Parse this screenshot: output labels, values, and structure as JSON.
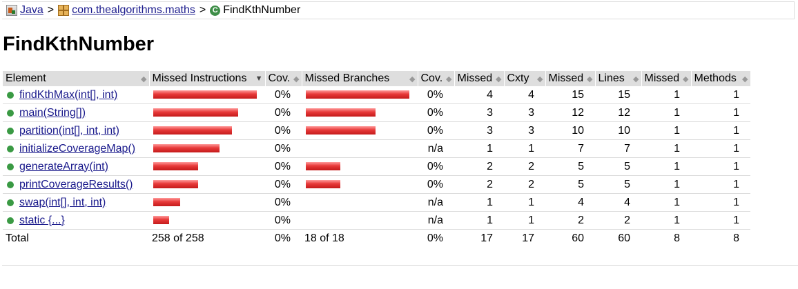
{
  "breadcrumb": {
    "items": [
      {
        "label": "Java",
        "icon": "java-report-icon"
      },
      {
        "label": "com.thealgorithms.maths",
        "icon": "package-icon"
      }
    ],
    "separator": ">",
    "current": {
      "label": "FindKthNumber",
      "icon": "class-icon",
      "icon_glyph": "C"
    }
  },
  "page_title": "FindKthNumber",
  "table": {
    "headers": {
      "element": "Element",
      "missed_instructions": "Missed Instructions",
      "cov_instructions": "Cov.",
      "missed_branches": "Missed Branches",
      "cov_branches": "Cov.",
      "missed_cxty": "Missed",
      "cxty": "Cxty",
      "missed_lines": "Missed",
      "lines": "Lines",
      "missed_methods": "Missed",
      "methods": "Methods"
    },
    "rows": [
      {
        "name": "findKthMax(int[], int)",
        "instr_fraction": 1.0,
        "instr_cov": "0%",
        "branch_fraction": 1.0,
        "branch_cov": "0%",
        "missed_cxty": "4",
        "cxty": "4",
        "missed_lines": "15",
        "lines": "15",
        "missed_methods": "1",
        "methods": "1"
      },
      {
        "name": "main(String[])",
        "instr_fraction": 0.82,
        "instr_cov": "0%",
        "branch_fraction": 0.67,
        "branch_cov": "0%",
        "missed_cxty": "3",
        "cxty": "3",
        "missed_lines": "12",
        "lines": "12",
        "missed_methods": "1",
        "methods": "1"
      },
      {
        "name": "partition(int[], int, int)",
        "instr_fraction": 0.76,
        "instr_cov": "0%",
        "branch_fraction": 0.67,
        "branch_cov": "0%",
        "missed_cxty": "3",
        "cxty": "3",
        "missed_lines": "10",
        "lines": "10",
        "missed_methods": "1",
        "methods": "1"
      },
      {
        "name": "initializeCoverageMap()",
        "instr_fraction": 0.64,
        "instr_cov": "0%",
        "branch_fraction": 0,
        "branch_cov": "n/a",
        "missed_cxty": "1",
        "cxty": "1",
        "missed_lines": "7",
        "lines": "7",
        "missed_methods": "1",
        "methods": "1"
      },
      {
        "name": "generateArray(int)",
        "instr_fraction": 0.43,
        "instr_cov": "0%",
        "branch_fraction": 0.33,
        "branch_cov": "0%",
        "missed_cxty": "2",
        "cxty": "2",
        "missed_lines": "5",
        "lines": "5",
        "missed_methods": "1",
        "methods": "1"
      },
      {
        "name": "printCoverageResults()",
        "instr_fraction": 0.43,
        "instr_cov": "0%",
        "branch_fraction": 0.33,
        "branch_cov": "0%",
        "missed_cxty": "2",
        "cxty": "2",
        "missed_lines": "5",
        "lines": "5",
        "missed_methods": "1",
        "methods": "1"
      },
      {
        "name": "swap(int[], int, int)",
        "instr_fraction": 0.26,
        "instr_cov": "0%",
        "branch_fraction": 0,
        "branch_cov": "n/a",
        "missed_cxty": "1",
        "cxty": "1",
        "missed_lines": "4",
        "lines": "4",
        "missed_methods": "1",
        "methods": "1"
      },
      {
        "name": "static {...}",
        "instr_fraction": 0.15,
        "instr_cov": "0%",
        "branch_fraction": 0,
        "branch_cov": "n/a",
        "missed_cxty": "1",
        "cxty": "1",
        "missed_lines": "2",
        "lines": "2",
        "missed_methods": "1",
        "methods": "1"
      }
    ],
    "total": {
      "label": "Total",
      "missed_instructions": "258 of 258",
      "instr_cov": "0%",
      "missed_branches": "18 of 18",
      "branch_cov": "0%",
      "missed_cxty": "17",
      "cxty": "17",
      "missed_lines": "60",
      "lines": "60",
      "missed_methods": "8",
      "methods": "8"
    }
  },
  "colors": {
    "bar_red": "#e83a3a",
    "method_dot": "#3a9a44",
    "link": "#1a1a8c",
    "header_bg": "#dedede"
  }
}
